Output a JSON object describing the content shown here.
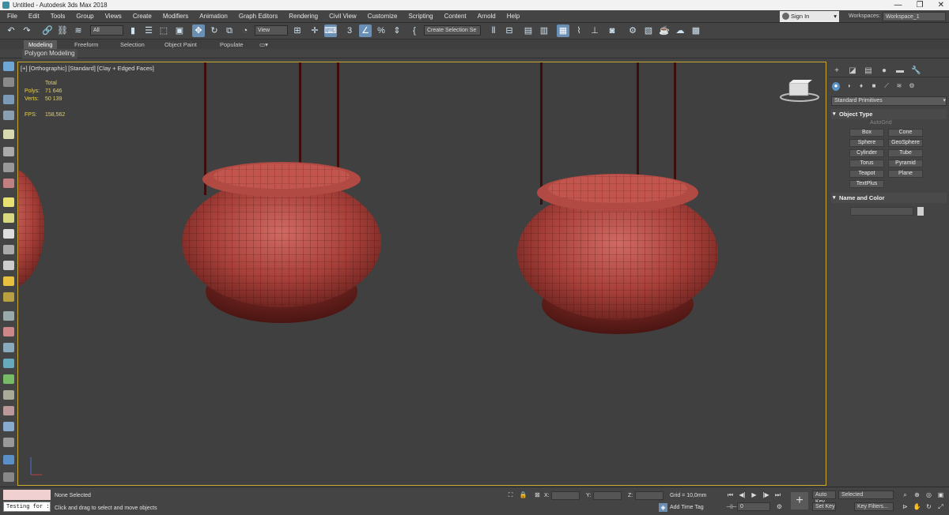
{
  "window": {
    "title": "Untitled - Autodesk 3ds Max 2018",
    "controls": [
      "—",
      "❐",
      "✕"
    ]
  },
  "menu": {
    "items": [
      "File",
      "Edit",
      "Tools",
      "Group",
      "Views",
      "Create",
      "Modifiers",
      "Animation",
      "Graph Editors",
      "Rendering",
      "Civil View",
      "Customize",
      "Scripting",
      "Content",
      "Arnold",
      "Help"
    ],
    "signin": "Sign In",
    "workspaces_label": "Workspaces:",
    "workspace_value": "Workspace_1"
  },
  "toolbar": {
    "filter_value": "All",
    "refcoord_value": "View",
    "selection_set": "Create Selection Se"
  },
  "ribbon": {
    "tabs": [
      "Modeling",
      "Freeform",
      "Selection",
      "Object Paint",
      "Populate"
    ],
    "active_tab": "Modeling",
    "sub_label": "Polygon Modeling"
  },
  "viewport": {
    "label": "[+] [Orthographic] [Standard] [Clay + Edged Faces]",
    "stats": {
      "total_label": "Total",
      "polys_label": "Polys:",
      "polys_value": "71 646",
      "verts_label": "Verts:",
      "verts_value": "50 139",
      "fps_label": "FPS:",
      "fps_value": "158,562"
    },
    "accent": "#c8a82e",
    "object_color": "#a8403a"
  },
  "command_panel": {
    "dropdown": "Standard Primitives",
    "object_type_title": "Object Type",
    "autogrid": "AutoGrid",
    "primitives": [
      "Box",
      "Cone",
      "Sphere",
      "GeoSphere",
      "Cylinder",
      "Tube",
      "Torus",
      "Pyramid",
      "Teapot",
      "Plane",
      "TextPlus"
    ],
    "name_color_title": "Name and Color"
  },
  "status": {
    "maxscript_text": "Testing for :",
    "selection": "None Selected",
    "prompt": "Click and drag to select and move objects",
    "x_label": "X:",
    "y_label": "Y:",
    "z_label": "Z:",
    "grid": "Grid = 10,0mm",
    "add_time_tag": "Add Time Tag",
    "auto_key": "Auto Key",
    "set_key": "Set Key",
    "selected": "Selected",
    "key_filters": "Key Filters...",
    "frame": "0"
  }
}
